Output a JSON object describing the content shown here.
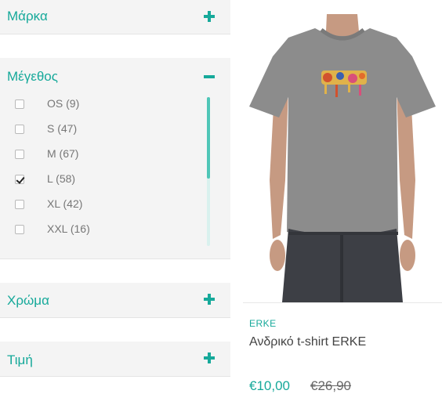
{
  "filters": {
    "brand": {
      "title": "Μάρκα",
      "state": "collapsed",
      "toggle": "plus-icon"
    },
    "size": {
      "title": "Μέγεθος",
      "state": "expanded",
      "toggle": "minus-icon",
      "options": [
        {
          "label": "OS (9)",
          "checked": false
        },
        {
          "label": "S (47)",
          "checked": false
        },
        {
          "label": "M (67)",
          "checked": false
        },
        {
          "label": "L (58)",
          "checked": true
        },
        {
          "label": "XL (42)",
          "checked": false
        },
        {
          "label": "XXL (16)",
          "checked": false
        }
      ]
    },
    "color": {
      "title": "Χρώμα",
      "state": "collapsed",
      "toggle": "plus-icon"
    },
    "price": {
      "title": "Τιμή",
      "state": "collapsed",
      "toggle": "plus-icon"
    }
  },
  "product": {
    "brand": "ERKE",
    "name": "Ανδρικό t-shirt ERKE",
    "price": "€10,00",
    "old_price": "€26,90"
  },
  "colors": {
    "accent": "#16a99a",
    "panel_bg": "#f4f4f4",
    "shirt": "#8a8a8a",
    "jeans": "#3d3f45"
  }
}
